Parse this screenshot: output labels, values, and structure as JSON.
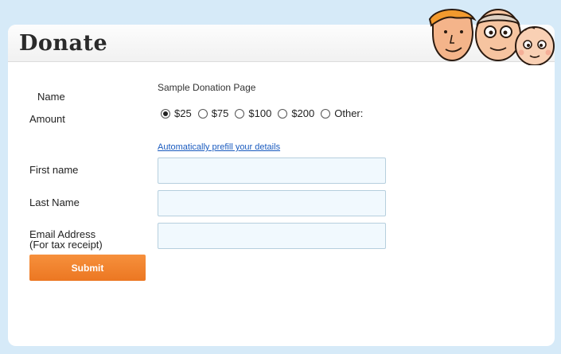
{
  "header": {
    "title": "Donate",
    "illustration": "family-faces-illustration"
  },
  "form": {
    "subtitle": "Sample Donation Page",
    "labels": {
      "name": "Name",
      "amount": "Amount",
      "first_name": "First name",
      "last_name": "Last Name",
      "email_line1": "Email Address",
      "email_line2": "(For tax receipt)"
    },
    "amount_options": [
      {
        "label": "$25",
        "selected": true
      },
      {
        "label": "$75",
        "selected": false
      },
      {
        "label": "$100",
        "selected": false
      },
      {
        "label": "$200",
        "selected": false
      },
      {
        "label": "Other:",
        "selected": false
      }
    ],
    "prefill_link": "Automatically prefill your details",
    "fields": {
      "first_name": {
        "value": "",
        "placeholder": ""
      },
      "last_name": {
        "value": "",
        "placeholder": ""
      },
      "email": {
        "value": "",
        "placeholder": ""
      }
    },
    "submit_label": "Submit"
  },
  "colors": {
    "page_background": "#d6eaf8",
    "submit_button": "#f08530",
    "link": "#1a5bbf",
    "field_background": "#f1f9fe"
  }
}
